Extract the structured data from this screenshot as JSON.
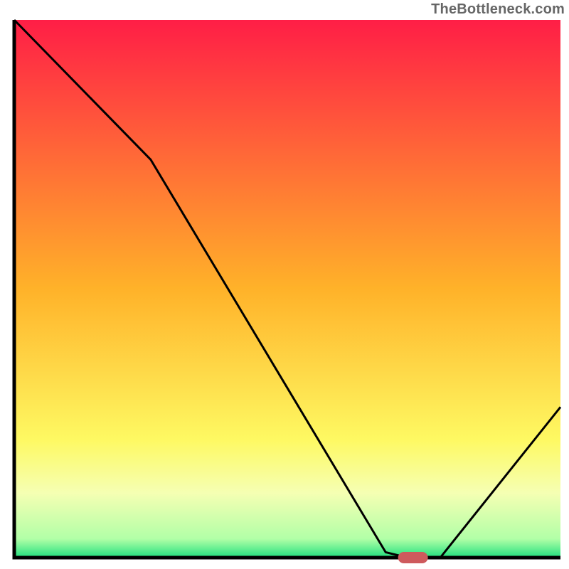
{
  "watermark": "TheBottleneck.com",
  "chart_data": {
    "type": "line",
    "title": "",
    "xlabel": "",
    "ylabel": "",
    "xlim": [
      0,
      100
    ],
    "ylim": [
      0,
      100
    ],
    "x": [
      0,
      25,
      68,
      72,
      78,
      100
    ],
    "values": [
      100,
      74,
      1,
      0,
      0,
      28
    ],
    "marker": {
      "x": 73,
      "y": 0
    },
    "gradient_stops": [
      {
        "offset": 0.0,
        "color": "#ff1e46"
      },
      {
        "offset": 0.5,
        "color": "#ffb229"
      },
      {
        "offset": 0.78,
        "color": "#fef962"
      },
      {
        "offset": 0.88,
        "color": "#f5ffb3"
      },
      {
        "offset": 0.965,
        "color": "#b2ffa7"
      },
      {
        "offset": 1.0,
        "color": "#20e07e"
      }
    ],
    "colors": {
      "curve": "#000000",
      "axis": "#000000",
      "marker": "#ce5a5d"
    }
  }
}
